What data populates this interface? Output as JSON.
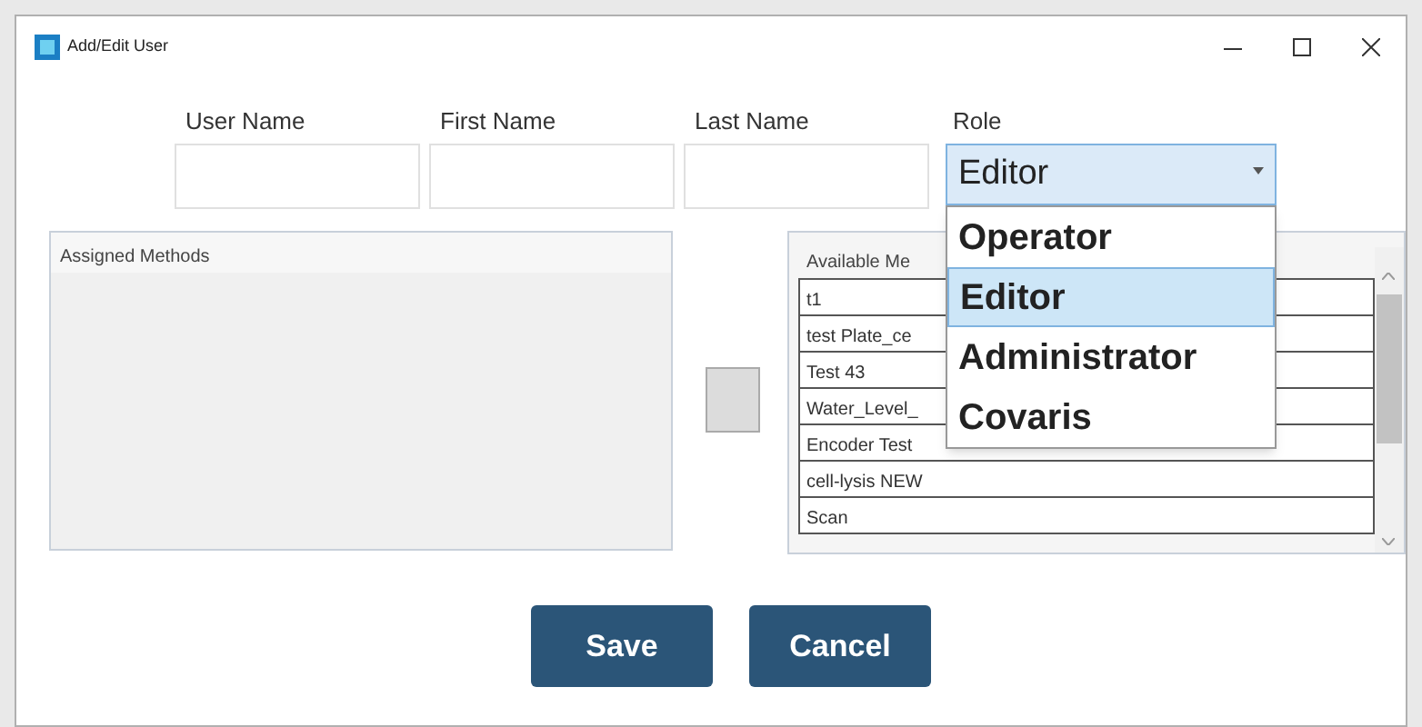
{
  "window": {
    "title": "Add/Edit User"
  },
  "fields": [
    {
      "label": "User Name"
    },
    {
      "label": "First Name"
    },
    {
      "label": "Last Name"
    }
  ],
  "role": {
    "label": "Role",
    "value": "Editor",
    "expanded": true,
    "options": [
      {
        "label": "Operator",
        "selected": false
      },
      {
        "label": "Editor",
        "selected": true
      },
      {
        "label": "Administrator",
        "selected": false
      },
      {
        "label": "Covaris",
        "selected": false
      }
    ]
  },
  "assigned_methods": {
    "header": "Assigned Methods"
  },
  "available_methods": {
    "header": "Available Me",
    "rows": [
      "t1",
      "test Plate_ce",
      "Test 43",
      "Water_Level_",
      "Encoder Test",
      "cell-lysis NEW",
      "Scan"
    ]
  },
  "buttons": [
    "Save",
    "Cancel"
  ]
}
